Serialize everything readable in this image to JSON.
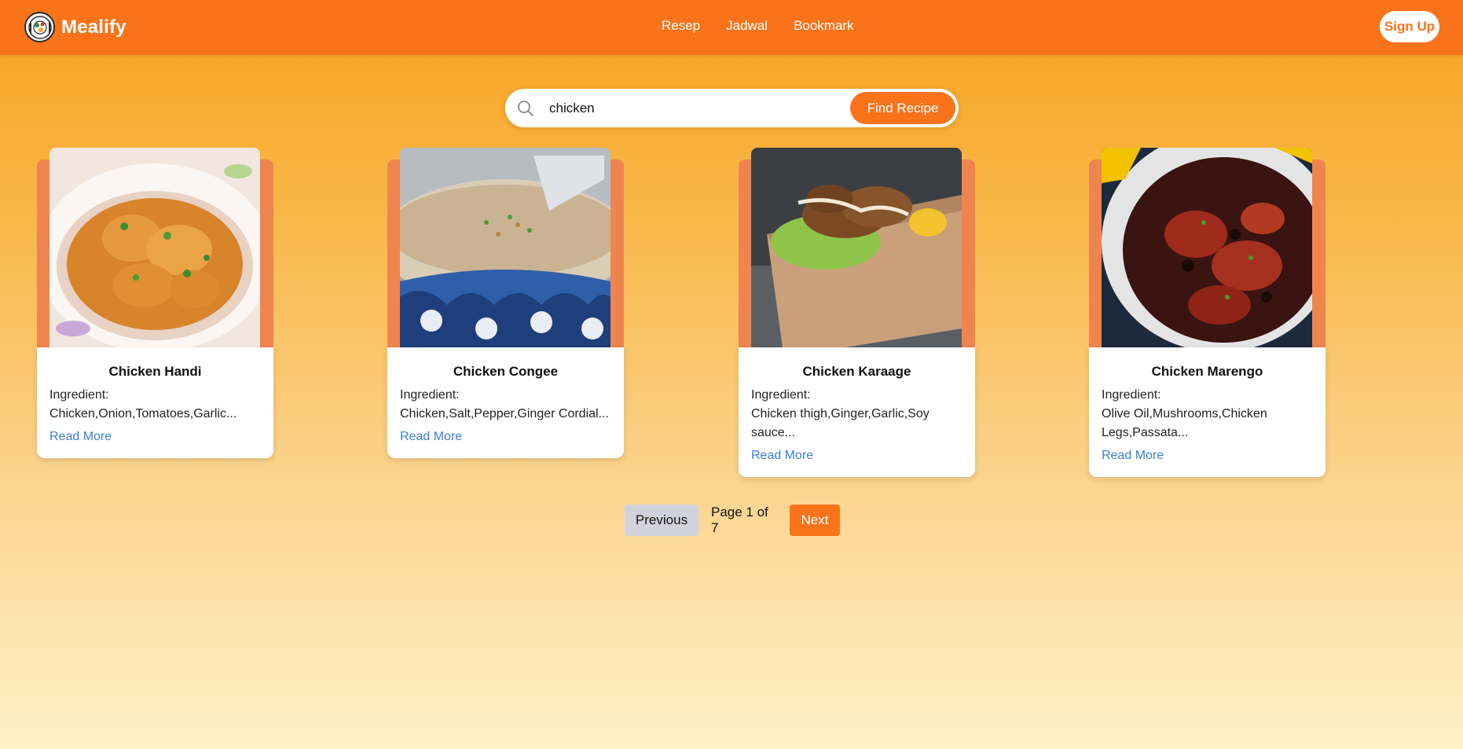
{
  "brand": {
    "name": "Mealify",
    "icon": "logo-icon"
  },
  "nav": {
    "items": [
      "Resep",
      "Jadwal",
      "Bookmark"
    ]
  },
  "header": {
    "signup_label": "Sign Up"
  },
  "search": {
    "value": "chicken",
    "placeholder": "",
    "button_label": "Find Recipe",
    "icon": "search-icon"
  },
  "recipes": [
    {
      "title": "Chicken Handi",
      "ingredient_label": "Ingredient:",
      "ingredients": "Chicken,Onion,Tomatoes,Garlic...",
      "link": "Read More"
    },
    {
      "title": "Chicken Congee",
      "ingredient_label": "Ingredient:",
      "ingredients": "Chicken,Salt,Pepper,Ginger Cordial...",
      "link": "Read More"
    },
    {
      "title": "Chicken Karaage",
      "ingredient_label": "Ingredient:",
      "ingredients": "Chicken thigh,Ginger,Garlic,Soy sauce...",
      "link": "Read More"
    },
    {
      "title": "Chicken Marengo",
      "ingredient_label": "Ingredient:",
      "ingredients": "Olive Oil,Mushrooms,Chicken Legs,Passata...",
      "link": "Read More"
    }
  ],
  "pagination": {
    "prev_label": "Previous",
    "page_text": "Page 1 of 7",
    "next_label": "Next"
  },
  "colors": {
    "primary": "#f9731a",
    "accent": "#f0844f",
    "link": "#3b7fd4"
  }
}
